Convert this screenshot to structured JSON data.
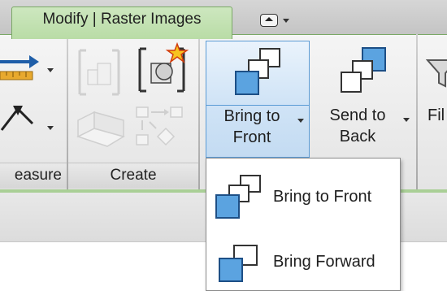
{
  "tabs": {
    "active_label": "Modify | Raster Images"
  },
  "quick_access": {
    "icon": "view-dropdown-icon"
  },
  "panels": {
    "measure": {
      "label": "easure"
    },
    "create": {
      "label": "Create"
    }
  },
  "buttons": {
    "bring_to_front": {
      "line1": "Bring to",
      "line2": "Front"
    },
    "send_to_back": {
      "line1": "Send to",
      "line2": "Back"
    },
    "filter": {
      "label": "Fil"
    }
  },
  "menu": {
    "items": [
      {
        "label": "Bring to Front",
        "icon": "bring-to-front-icon"
      },
      {
        "label": "Bring Forward",
        "icon": "bring-forward-icon"
      }
    ]
  },
  "colors": {
    "tab_green": "#b9dca6",
    "selection_blue": "#5b9bd5",
    "icon_blue": "#5ba3e0"
  }
}
